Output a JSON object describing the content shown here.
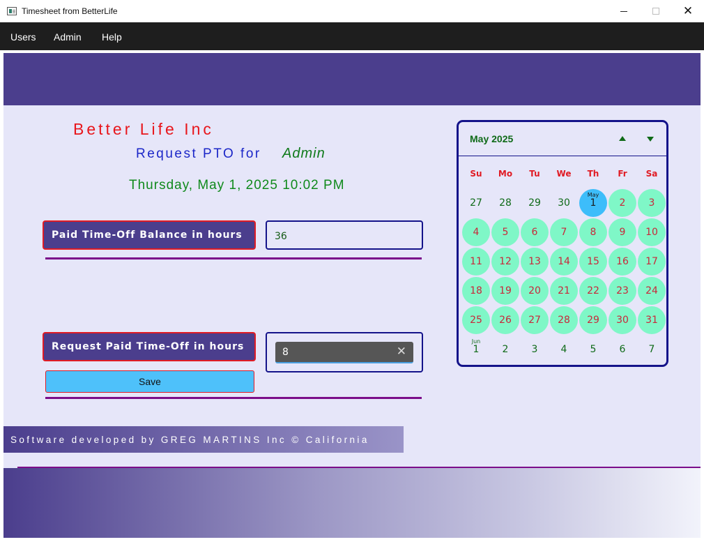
{
  "window": {
    "title": "Timesheet from BetterLife"
  },
  "menu": [
    "Users",
    "Admin",
    "Help"
  ],
  "header": {
    "company": "Better Life Inc",
    "request_label": "Request PTO for",
    "user": "Admin",
    "datetime": "Thursday, May 1, 2025 10:02 PM"
  },
  "balance": {
    "label": "Paid Time-Off Balance in hours",
    "value": "36"
  },
  "request": {
    "label": "Request Paid Time-Off in hours",
    "value": "8",
    "clear_glyph": "✕"
  },
  "save_label": "Save",
  "footer": "Software developed by GREG MARTINS Inc © California",
  "calendar": {
    "month_label": "May 2025",
    "weekdays": [
      "Su",
      "Mo",
      "Tu",
      "We",
      "Th",
      "Fr",
      "Sa"
    ],
    "today_month": "May",
    "next_month": "Jun",
    "days": [
      [
        "27",
        "28",
        "29",
        "30",
        "1",
        "2",
        "3"
      ],
      [
        "4",
        "5",
        "6",
        "7",
        "8",
        "9",
        "10"
      ],
      [
        "11",
        "12",
        "13",
        "14",
        "15",
        "16",
        "17"
      ],
      [
        "18",
        "19",
        "20",
        "21",
        "22",
        "23",
        "24"
      ],
      [
        "25",
        "26",
        "27",
        "28",
        "29",
        "30",
        "31"
      ],
      [
        "1",
        "2",
        "3",
        "4",
        "5",
        "6",
        "7"
      ]
    ],
    "colors": {
      "active_day": "#7ff7c7",
      "today": "#3dbdfa",
      "weekday": "#e01b24",
      "other_month": "#0f6a18"
    }
  },
  "colors": {
    "brand": "#4b3e8d",
    "accent_red": "#e01b24",
    "save_button": "#4ec1fa",
    "divider": "#7b0d8a"
  }
}
